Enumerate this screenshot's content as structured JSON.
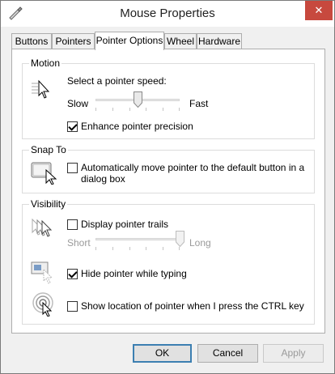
{
  "window": {
    "title": "Mouse Properties",
    "close_glyph": "✕"
  },
  "tabs": [
    {
      "label": "Buttons"
    },
    {
      "label": "Pointers"
    },
    {
      "label": "Pointer Options",
      "active": true
    },
    {
      "label": "Wheel"
    },
    {
      "label": "Hardware"
    }
  ],
  "motion": {
    "title": "Motion",
    "prompt": "Select a pointer speed:",
    "slow_label": "Slow",
    "fast_label": "Fast",
    "speed_level": 0.5,
    "enhance_precision": {
      "label": "Enhance pointer precision",
      "checked": true
    }
  },
  "snap_to": {
    "title": "Snap To",
    "auto_move": {
      "label_line1": "Automatically move pointer to the default button in a",
      "label_line2": "dialog box",
      "checked": false
    }
  },
  "visibility": {
    "title": "Visibility",
    "trails": {
      "label": "Display pointer trails",
      "checked": false
    },
    "short_label": "Short",
    "long_label": "Long",
    "trail_level": 1.0,
    "hide_typing": {
      "label": "Hide pointer while typing",
      "checked": true
    },
    "show_ctrl": {
      "label": "Show location of pointer when I press the CTRL key",
      "checked": false
    }
  },
  "buttons": {
    "ok": "OK",
    "cancel": "Cancel",
    "apply": "Apply"
  },
  "icons": {
    "title": "mouse-icon",
    "motion": "pointer-speed-icon",
    "snap": "snap-to-button-icon",
    "trails": "pointer-trails-icon",
    "hide": "hide-pointer-icon",
    "ctrl": "pointer-location-icon"
  },
  "colors": {
    "close_button": "#c7493e",
    "default_button_border": "#3c7fb1"
  }
}
